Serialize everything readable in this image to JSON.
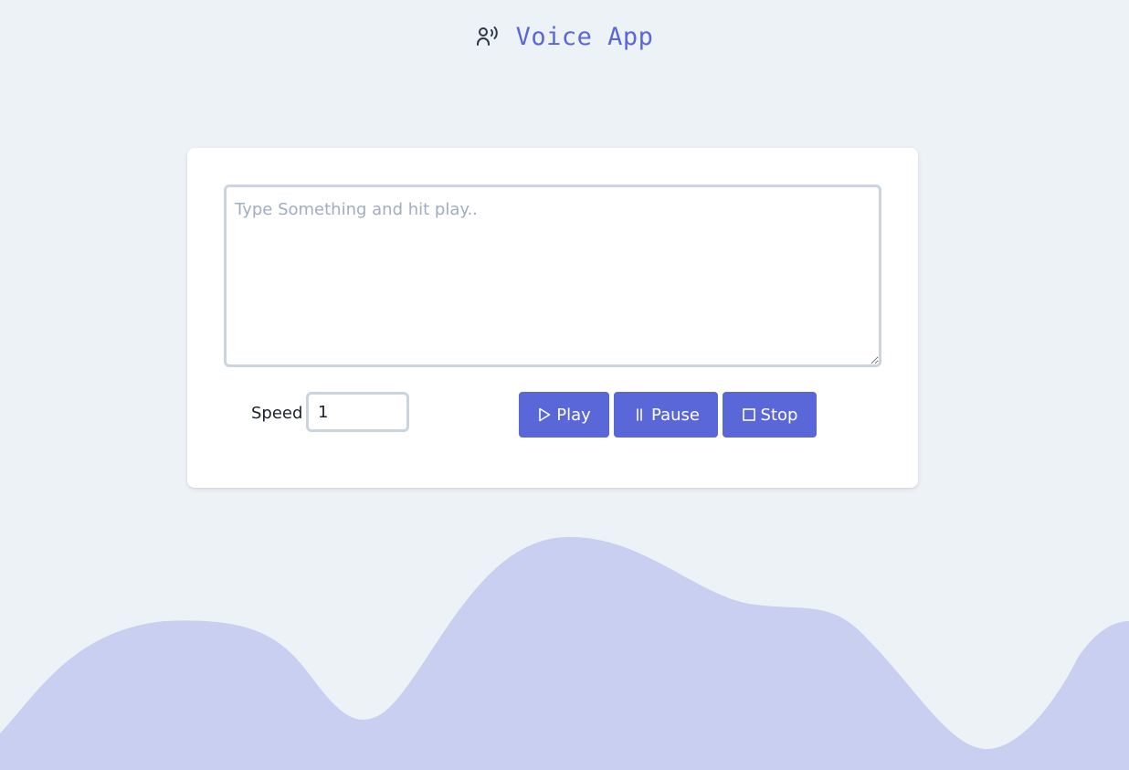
{
  "header": {
    "title": "Voice App",
    "icon": "voice-icon"
  },
  "editor": {
    "placeholder": "Type Something and hit play..",
    "value": ""
  },
  "controls": {
    "speed_label": "Speed",
    "speed_value": "1",
    "play_label": "Play",
    "pause_label": "Pause",
    "stop_label": "Stop",
    "play_icon": "play-icon",
    "pause_icon": "pause-icon",
    "stop_icon": "stop-icon"
  },
  "colors": {
    "background": "#edf2f7",
    "accent": "#5a67d8",
    "wave": "#c9cff0",
    "card": "#ffffff",
    "border": "#cbd5e0"
  }
}
